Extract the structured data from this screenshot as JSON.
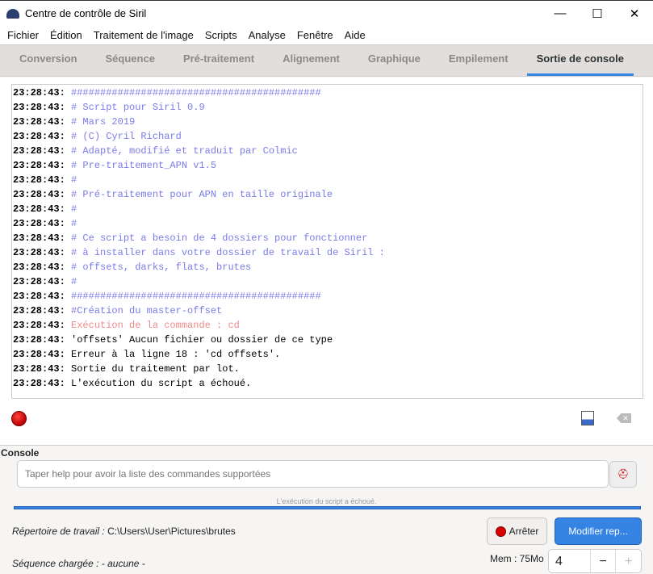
{
  "window": {
    "title": "Centre de contrôle de Siril",
    "minimize": "—",
    "maximize": "☐",
    "close": "✕"
  },
  "menu": [
    "Fichier",
    "Édition",
    "Traitement de l'image",
    "Scripts",
    "Analyse",
    "Fenêtre",
    "Aide"
  ],
  "tabs": [
    "Conversion",
    "Séquence",
    "Pré-traitement",
    "Alignement",
    "Graphique",
    "Empilement",
    "Sortie de console"
  ],
  "active_tab": "Sortie de console",
  "console_lines": [
    {
      "time": "23:28:43:",
      "text": "###########################################",
      "type": "comment"
    },
    {
      "time": "23:28:43:",
      "text": "# Script pour Siril 0.9",
      "type": "comment"
    },
    {
      "time": "23:28:43:",
      "text": "# Mars 2019",
      "type": "comment"
    },
    {
      "time": "23:28:43:",
      "text": "# (C) Cyril Richard",
      "type": "comment"
    },
    {
      "time": "23:28:43:",
      "text": "# Adapté, modifié et traduit par Colmic",
      "type": "comment"
    },
    {
      "time": "23:28:43:",
      "text": "# Pre-traitement_APN v1.5",
      "type": "comment"
    },
    {
      "time": "23:28:43:",
      "text": "#",
      "type": "comment"
    },
    {
      "time": "23:28:43:",
      "text": "# Pré-traitement pour APN en taille originale",
      "type": "comment"
    },
    {
      "time": "23:28:43:",
      "text": "#",
      "type": "comment"
    },
    {
      "time": "23:28:43:",
      "text": "#",
      "type": "comment"
    },
    {
      "time": "23:28:43:",
      "text": "# Ce script a besoin de 4 dossiers pour fonctionner",
      "type": "comment"
    },
    {
      "time": "23:28:43:",
      "text": "# à installer dans votre dossier de travail de Siril :",
      "type": "comment"
    },
    {
      "time": "23:28:43:",
      "text": "# offsets, darks, flats, brutes",
      "type": "comment"
    },
    {
      "time": "23:28:43:",
      "text": "#",
      "type": "comment"
    },
    {
      "time": "23:28:43:",
      "text": "###########################################",
      "type": "comment"
    },
    {
      "time": "23:28:43:",
      "text": "#Création du master-offset",
      "type": "comment"
    },
    {
      "time": "23:28:43:",
      "text": "Exécution de la commande : cd",
      "type": "cmd"
    },
    {
      "time": "23:28:43:",
      "text": "'offsets' Aucun fichier ou dossier de ce type",
      "type": "normal"
    },
    {
      "time": "23:28:43:",
      "text": "Erreur à la ligne 18 : 'cd offsets'.",
      "type": "normal"
    },
    {
      "time": "23:28:43:",
      "text": "Sortie du traitement par lot.",
      "type": "normal"
    },
    {
      "time": "23:28:43:",
      "text": "L'exécution du script a échoué.",
      "type": "normal"
    }
  ],
  "console": {
    "label": "Console",
    "placeholder": "Taper help pour avoir la liste des commandes supportées"
  },
  "progress": {
    "text": "L'exécution du script a échoué.",
    "value": 1.0
  },
  "workdir": {
    "label": "Répertoire de travail :",
    "path": "C:\\Users\\User\\Pictures\\brutes"
  },
  "buttons": {
    "stop": "Arrêter",
    "change_dir": "Modifier rep..."
  },
  "sequence": {
    "label": "Séquence chargée :",
    "value": "- aucune -"
  },
  "mem": "Mem : 75Mo",
  "threads": {
    "value": "4",
    "minus": "−",
    "plus": "+"
  },
  "colors": {
    "accent": "#3584e4",
    "comment": "#7b7bea",
    "command": "#f08a8a"
  }
}
